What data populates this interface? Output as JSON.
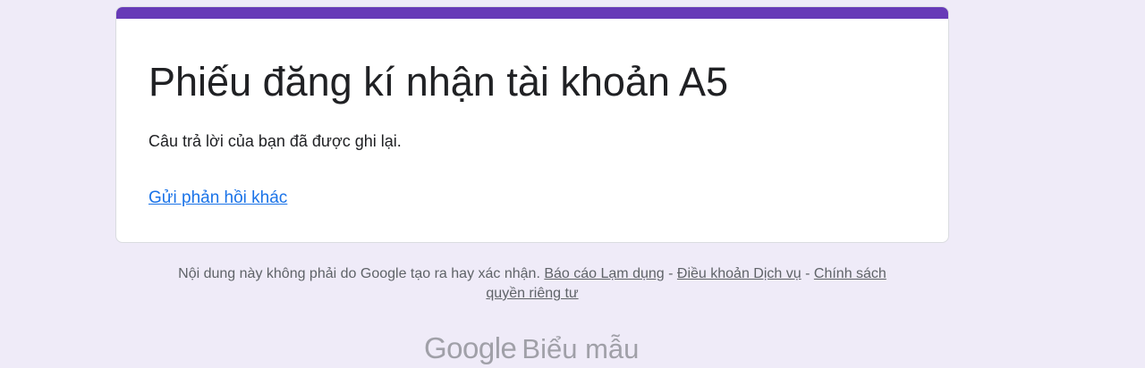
{
  "form": {
    "title": "Phiếu đăng kí nhận tài khoản A5",
    "confirmation_message": "Câu trả lời của bạn đã được ghi lại.",
    "resubmit_link": "Gửi phản hồi khác"
  },
  "footer": {
    "disclaimer": "Nội dung này không phải do Google tạo ra hay xác nhận.",
    "report_abuse": "Báo cáo Lạm dụng",
    "separator": "-",
    "terms": "Điều khoản Dịch vụ",
    "privacy_line1": "Chính sách",
    "privacy_line2": "quyền riêng tư"
  },
  "brand": {
    "google": "Google",
    "product": "Biểu mẫu"
  },
  "colors": {
    "background": "#efebf8",
    "accent": "#673ab7",
    "link": "#1a73e8",
    "footer_text": "#5f6368",
    "brand_text": "#a0a0a8"
  }
}
